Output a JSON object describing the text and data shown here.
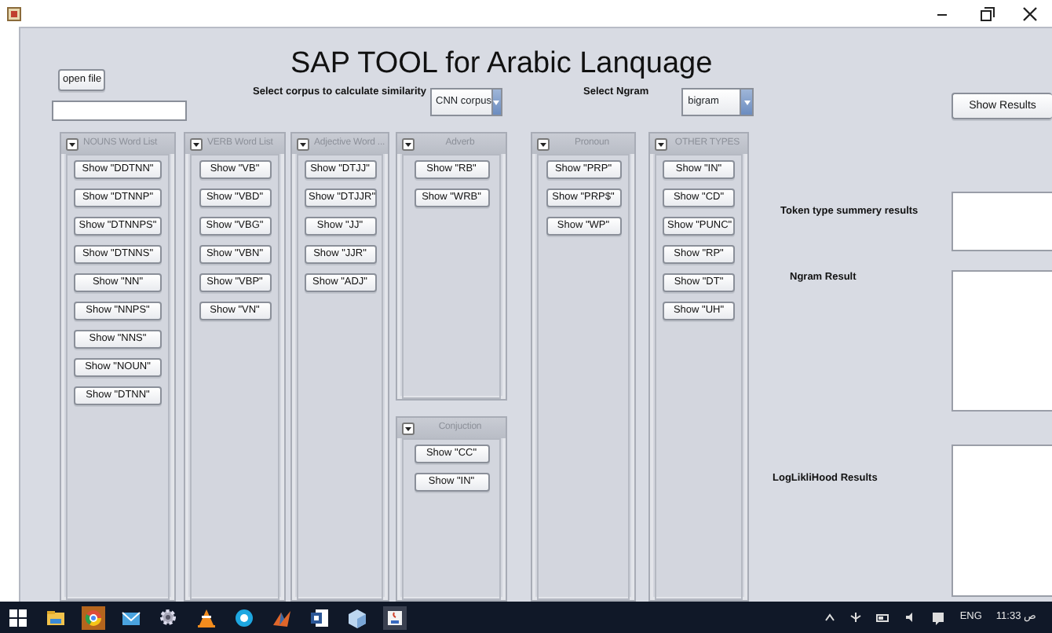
{
  "app_title": "SAP TOOL for Arabic Lanquage",
  "open_button": "open file",
  "corpus_label": "Select corpus to calculate similarity",
  "corpus_select": {
    "value": "CNN corpus"
  },
  "ngram_label": "Select Ngram",
  "ngram_select": {
    "value": "bigram"
  },
  "show_results_button": "Show Results",
  "panel_columns": [
    [
      {
        "title": "NOUNS Word List",
        "buttons": [
          "Show \"DDTNN\"",
          "Show \"DTNNP\"",
          "Show \"DTNNPS\"",
          "Show \"DTNNS\"",
          "Show \"NN\"",
          "Show \"NNPS\"",
          "Show \"NNS\"",
          "Show \"NOUN\"",
          "Show \"DTNN\""
        ]
      }
    ],
    [
      {
        "title": "VERB Word List",
        "buttons": [
          "Show \"VB\"",
          "Show \"VBD\"",
          "Show \"VBG\"",
          "Show \"VBN\"",
          "Show \"VBP\"",
          "Show \"VN\""
        ]
      }
    ],
    [
      {
        "title": "Adjective Word ...",
        "buttons": [
          "Show \"DTJJ\"",
          "Show \"DTJJR\"",
          "Show \"JJ\"",
          "Show \"JJR\"",
          "Show \"ADJ\""
        ]
      }
    ],
    [
      {
        "title": "Adverb",
        "buttons": [
          "Show \"RB\"",
          "Show \"WRB\""
        ]
      },
      {
        "title": "Conjuction",
        "buttons": [
          "Show \"CC\"",
          "Show \"IN\""
        ]
      }
    ],
    [
      {
        "title": "Pronoun",
        "buttons": [
          "Show \"PRP\"",
          "Show \"PRP$\"",
          "Show \"WP\""
        ]
      }
    ],
    [
      {
        "title": "OTHER TYPES",
        "buttons": [
          "Show \"IN\"",
          "Show \"CD\"",
          "Show \"PUNC\"",
          "Show \"RP\"",
          "Show \"DT\"",
          "Show \"UH\""
        ]
      }
    ]
  ],
  "results": [
    {
      "label": "Token type summery results"
    },
    {
      "label": "Ngram Result"
    },
    {
      "label": "LogLikliHood Results"
    }
  ],
  "taskbar": {
    "language": "ENG",
    "time": "11:33 ص"
  }
}
